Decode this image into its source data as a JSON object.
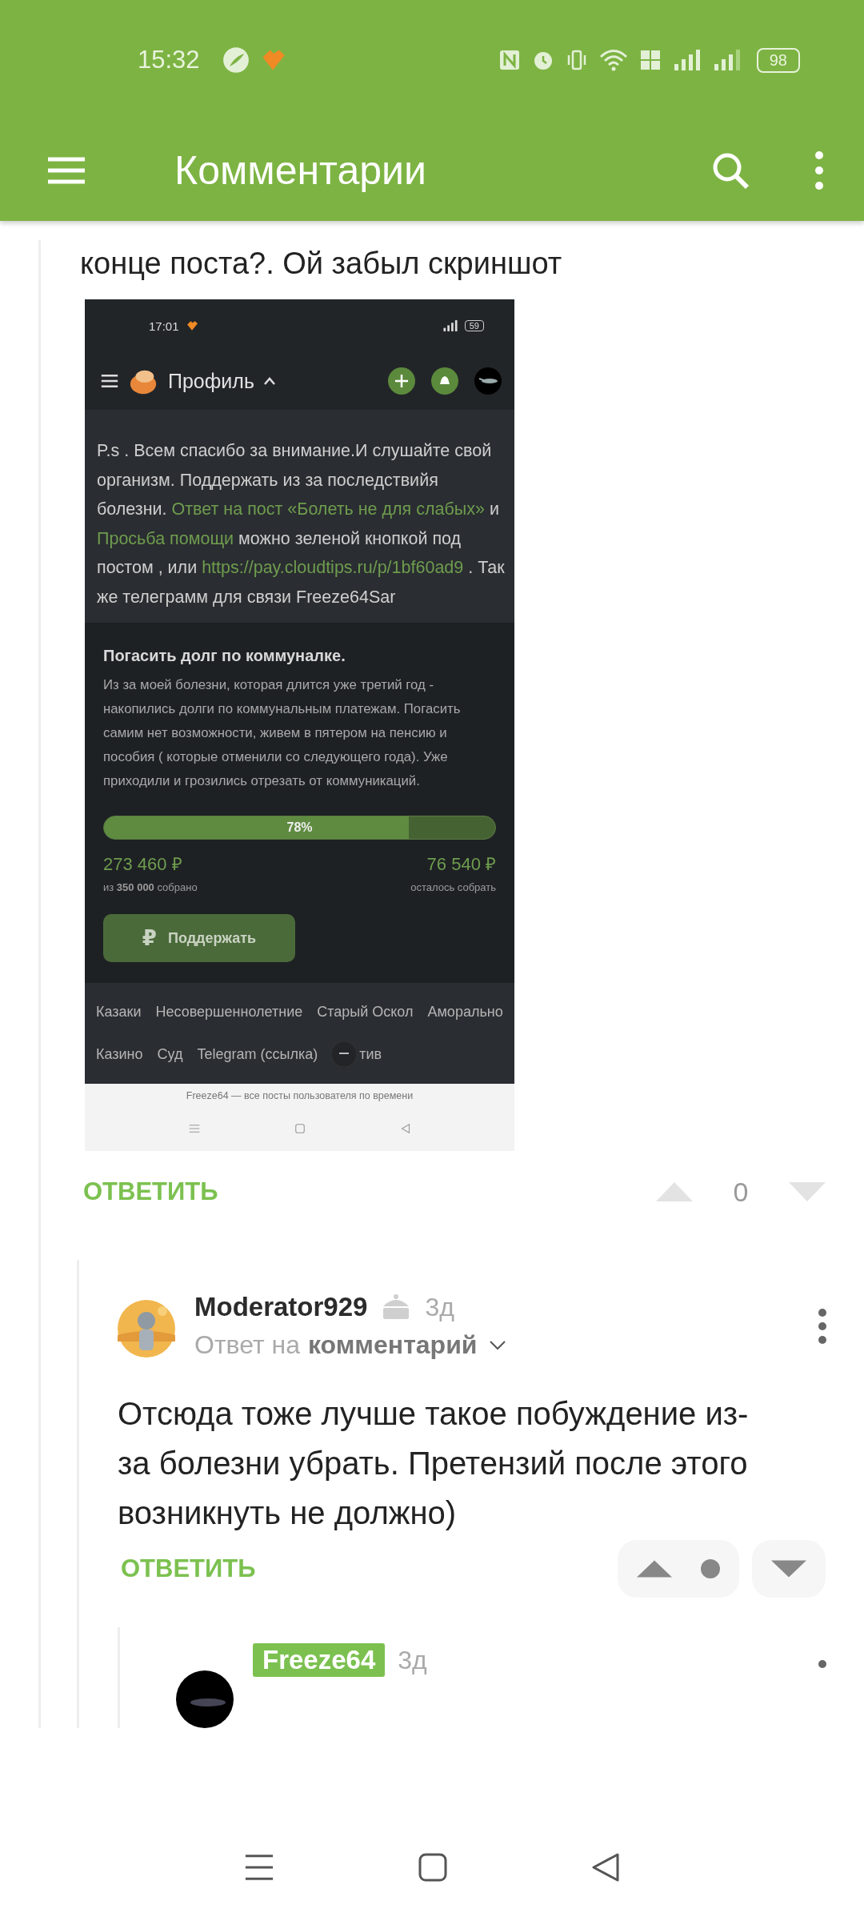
{
  "status_bar": {
    "time": "15:32",
    "battery": "98"
  },
  "app_bar": {
    "title": "Комментарии"
  },
  "comment": {
    "text": "конце поста?. Ой забыл скриншот",
    "attachment": {
      "status_bar": {
        "time": "17:01",
        "battery": "59"
      },
      "header": {
        "title": "Профиль"
      },
      "post_text": [
        {
          "kind": "text",
          "text": "P.s . Всем спасибо за внимание.И слушайте свой организм. Поддержать из за последствийя болезни. "
        },
        {
          "kind": "link",
          "text": "Ответ на пост «Болеть не для слабых»"
        },
        {
          "kind": "text",
          "text": " и "
        },
        {
          "kind": "link",
          "text": "Просьба помощи"
        },
        {
          "kind": "text",
          "text": " можно зеленой кнопкой под постом , или "
        },
        {
          "kind": "link",
          "text": "https://pay.cloudtips.ru/p/1bf60ad9"
        },
        {
          "kind": "text",
          "text": " . Так же телеграмм для связи Freeze64Sar"
        }
      ],
      "fundraiser": {
        "title": "Погасить долг по коммуналке.",
        "description": "Из за моей болезни, которая длится уже третий год - накопились долги по коммунальным платежам. Погасить самим нет возможности, живем в пятером на пенсию и пособия ( которые отменили со следующего года). Уже приходили и грозились отрезать от коммуникаций.",
        "level": 0.78,
        "percent": "78%",
        "collected": "273 460 ₽",
        "collected_note": "из **350 000** собрано",
        "remaining": "76 540 ₽",
        "remaining_note": "осталось собрать",
        "button_icon": "₽",
        "button": "Поддержать"
      },
      "tags": [
        "Казаки",
        "Несовершеннолетние",
        "Старый Оскол",
        "Аморально",
        "Казино",
        "Суд",
        "Telegram (ссылка)",
        "тив"
      ],
      "footer_link": "Freeze64 — все посты пользователя по времени"
    },
    "reply_label": "ОТВЕТИТЬ",
    "rating": "0"
  },
  "replies": [
    {
      "author": "Moderator929",
      "is_post_author": false,
      "time": "3д",
      "reply_prefix": "Ответ на",
      "reply_target": "комментарий",
      "text": "Отсюда тоже лучше такое побуждение из-за болезни убрать. Претензий после этого возникнуть не должно)",
      "reply_label": "ОТВЕТИТЬ"
    },
    {
      "author": "Freeze64",
      "is_post_author": true,
      "time": "3д"
    }
  ]
}
